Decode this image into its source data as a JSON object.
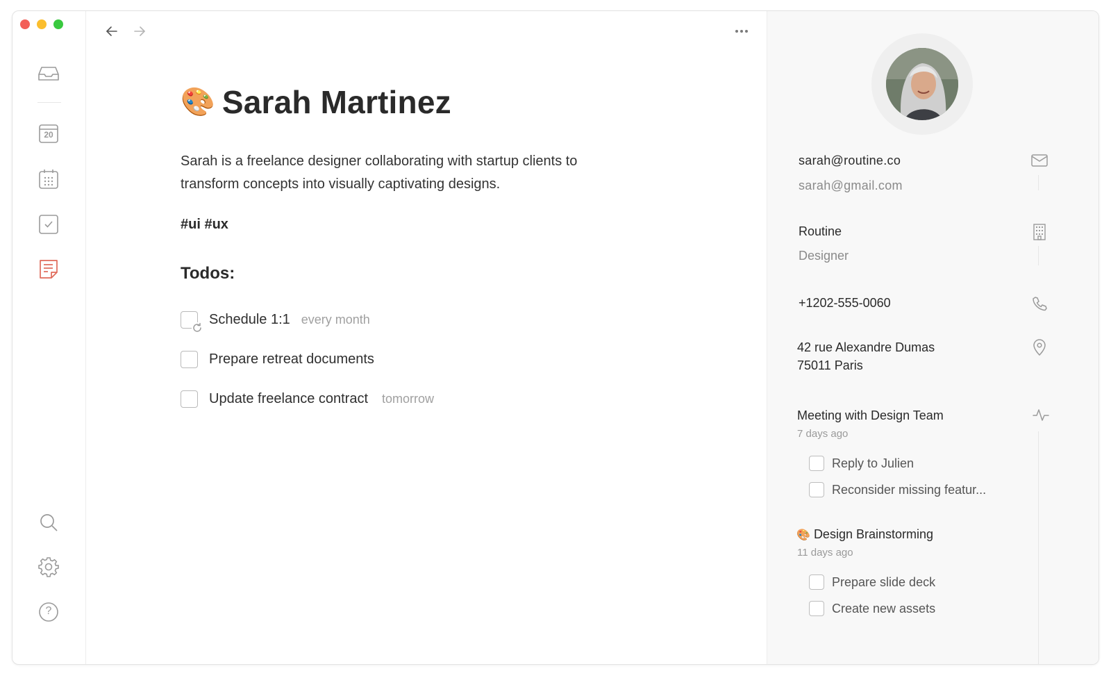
{
  "nav": {
    "back_icon": "arrow-left-icon",
    "forward_icon": "arrow-right-icon",
    "more_icon": "ellipsis-icon"
  },
  "sidebar": {
    "items": [
      {
        "name": "inbox",
        "icon": "inbox-icon"
      },
      {
        "name": "today",
        "icon": "calendar-day-icon",
        "label": "20"
      },
      {
        "name": "calendar",
        "icon": "calendar-grid-icon"
      },
      {
        "name": "tasks",
        "icon": "checkbox-icon"
      },
      {
        "name": "notes",
        "icon": "note-icon",
        "active": true
      },
      {
        "name": "search",
        "icon": "search-icon"
      },
      {
        "name": "settings",
        "icon": "gear-icon"
      },
      {
        "name": "help",
        "icon": "help-icon",
        "label": "?"
      }
    ],
    "active_color": "#e06a5a"
  },
  "page": {
    "emoji": "🎨",
    "title": "Sarah Martinez",
    "description_line1": "Sarah is a freelance designer collaborating with startup clients to",
    "description_line2": "transform concepts into visually captivating designs.",
    "tags": "#ui #ux",
    "todos_heading": "Todos:",
    "todos": [
      {
        "label": "Schedule 1:1",
        "meta": "every month",
        "recurring": true
      },
      {
        "label": "Prepare retreat documents",
        "meta": ""
      },
      {
        "label": "Update freelance contract",
        "meta": "tomorrow"
      }
    ]
  },
  "contact": {
    "email_primary": "sarah@routine.co",
    "email_secondary": "sarah@gmail.com",
    "company": "Routine",
    "role": "Designer",
    "phone": "+1202-555-0060",
    "address_line1": "42 rue Alexandre Dumas",
    "address_line2": "75011 Paris",
    "icons": [
      "mail-icon",
      "building-icon",
      "phone-icon",
      "location-pin-icon",
      "activity-icon"
    ]
  },
  "activity": [
    {
      "title": "Meeting with Design Team",
      "emoji": "",
      "when": "7 days ago",
      "todos": [
        "Reply to Julien",
        "Reconsider missing featur..."
      ]
    },
    {
      "title": "Design Brainstorming",
      "emoji": "🎨",
      "when": "11 days ago",
      "todos": [
        "Prepare slide deck",
        "Create new assets"
      ]
    }
  ]
}
